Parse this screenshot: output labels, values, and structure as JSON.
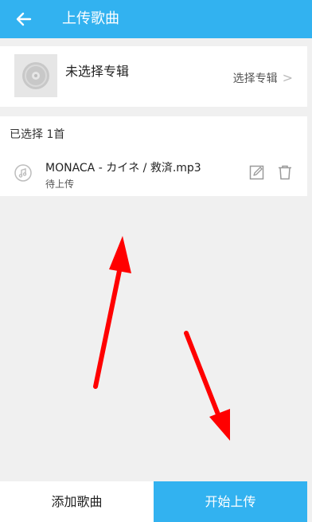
{
  "header": {
    "title": "上传歌曲",
    "back_icon": "arrow-left-icon"
  },
  "album": {
    "label": "未选择专辑",
    "select_text": "选择专辑",
    "chevron": "chevron-right-icon",
    "cover_icon": "vinyl-disc-icon"
  },
  "selection": {
    "count_text": "已选择 1首",
    "songs": [
      {
        "name": "MONACA - カイネ / 救済.mp3",
        "status": "待上传",
        "icon": "music-note-icon"
      }
    ]
  },
  "actions": {
    "add_label": "添加歌曲",
    "upload_label": "开始上传"
  },
  "colors": {
    "accent": "#32b2f0",
    "annotation_arrow": "#ff0000"
  }
}
